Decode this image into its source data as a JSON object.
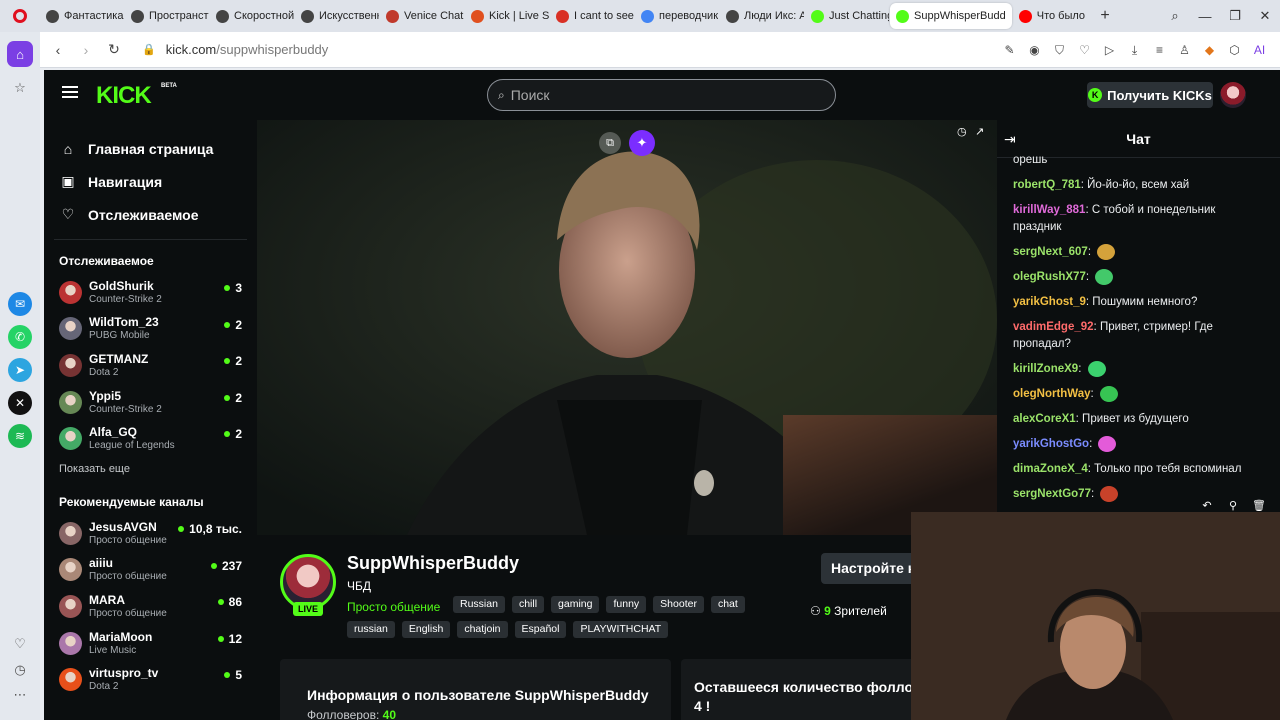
{
  "browser": {
    "tabs": [
      {
        "label": "Фантастика с",
        "color": "#444"
      },
      {
        "label": "Пространств",
        "color": "#444"
      },
      {
        "label": "Скоростной",
        "color": "#444"
      },
      {
        "label": "Искусственн",
        "color": "#444"
      },
      {
        "label": "Venice Chat",
        "color": "#c0392b"
      },
      {
        "label": "Kick | Live Str",
        "color": "#e0501f"
      },
      {
        "label": "I cant to see",
        "color": "#d93025"
      },
      {
        "label": "переводчик",
        "color": "#4285f4"
      },
      {
        "label": "Люди Икс: А",
        "color": "#444"
      },
      {
        "label": "Just Chatting",
        "color": "#53fc18"
      },
      {
        "label": "SuppWhisperBudd",
        "color": "#53fc18",
        "active": true
      },
      {
        "label": "Что было",
        "color": "#ff0000"
      }
    ],
    "url_host": "kick.com",
    "url_path": "/suppwhisperbuddy"
  },
  "kick": {
    "logo": "KICK",
    "beta": "BETA",
    "search_placeholder": "Поиск",
    "kicks_button": "Получить KICKs",
    "nav": [
      {
        "label": "Главная страница",
        "icon": "home-icon",
        "glyph": "⌂"
      },
      {
        "label": "Навигация",
        "icon": "browse-icon",
        "glyph": "▣"
      },
      {
        "label": "Отслеживаемое",
        "icon": "heart-icon",
        "glyph": "♡"
      }
    ],
    "followed_title": "Отслеживаемое",
    "followed": [
      {
        "name": "GoldShurik",
        "category": "Counter-Strike 2",
        "viewers": "3",
        "color": "#b33"
      },
      {
        "name": "WildTom_23",
        "category": "PUBG Mobile",
        "viewers": "2",
        "color": "#667"
      },
      {
        "name": "GETMANZ",
        "category": "Dota 2",
        "viewers": "2",
        "color": "#733"
      },
      {
        "name": "Yppi5",
        "category": "Counter-Strike 2",
        "viewers": "2",
        "color": "#685"
      },
      {
        "name": "Alfa_GQ",
        "category": "League of Legends",
        "viewers": "2",
        "color": "#4a6"
      }
    ],
    "show_more": "Показать еще",
    "recommended_title": "Рекомендуемые каналы",
    "recommended": [
      {
        "name": "JesusAVGN",
        "category": "Просто общение",
        "viewers": "10,8 тыс.",
        "color": "#866"
      },
      {
        "name": "aiiiu",
        "category": "Просто общение",
        "viewers": "237",
        "color": "#a87"
      },
      {
        "name": "MARA",
        "category": "Просто общение",
        "viewers": "86",
        "color": "#955"
      },
      {
        "name": "MariaMoon",
        "category": "Live Music",
        "viewers": "12",
        "color": "#a7a"
      },
      {
        "name": "virtuspro_tv",
        "category": "Dota 2",
        "viewers": "5",
        "color": "#e8501a"
      }
    ],
    "chat": {
      "title": "Чат",
      "messages": [
        {
          "user": "",
          "text": "орешь",
          "color": "#fff"
        },
        {
          "user": "robertQ_781",
          "text": "Йо-йо-йо, всем хай",
          "color": "#9be36a"
        },
        {
          "user": "kirillWay_881",
          "text": "С тобой и понедельник праздник",
          "color": "#e06ad9"
        },
        {
          "user": "sergNext_607",
          "text": "",
          "color": "#9be36a",
          "emote": "#d4a23b"
        },
        {
          "user": "olegRushX77",
          "text": "",
          "color": "#9be36a",
          "emote": "#43c96a"
        },
        {
          "user": "yarikGhost_9",
          "text": "Пошумим немного?",
          "color": "#f3c044"
        },
        {
          "user": "vadimEdge_92",
          "text": "Привет, стример! Где пропадал?",
          "color": "#ff6b6b"
        },
        {
          "user": "kirillZoneX9",
          "text": "",
          "color": "#9be36a",
          "emote": "#3bd16e"
        },
        {
          "user": "olegNorthWay",
          "text": "",
          "color": "#f3c044",
          "emote": "#37c453"
        },
        {
          "user": "alexCoreX1",
          "text": "Привет из будущего",
          "color": "#9be36a"
        },
        {
          "user": "yarikGhostGo",
          "text": "",
          "color": "#7b8cff",
          "emote": "#e35bd9"
        },
        {
          "user": "dimaZoneX_4",
          "text": "Только про тебя вспоминал",
          "color": "#9be36a"
        },
        {
          "user": "sergNextGo77",
          "text": "",
          "color": "#9be36a",
          "emote": "#c8422a"
        }
      ]
    },
    "channel": {
      "name": "SuppWhisperBuddy",
      "subtitle": "ЧБД",
      "live": "LIVE",
      "category": "Просто общение",
      "tags_row1": [
        "Russian",
        "chill",
        "gaming",
        "funny",
        "Shooter",
        "chat"
      ],
      "tags_row2": [
        "russian",
        "English",
        "chatjoin",
        "Español",
        "PLAYWITHCHAT"
      ],
      "setup_button": "Настройте к",
      "viewers_count": "9",
      "viewers_label": "Зрителей",
      "about_title": "Информация о пользователе SuppWhisperBuddy",
      "followers_label": "Фолловеров:",
      "followers_count": "40",
      "remaining_title": "Оставшееся количество фоллов",
      "remaining_count": "4 !"
    }
  }
}
